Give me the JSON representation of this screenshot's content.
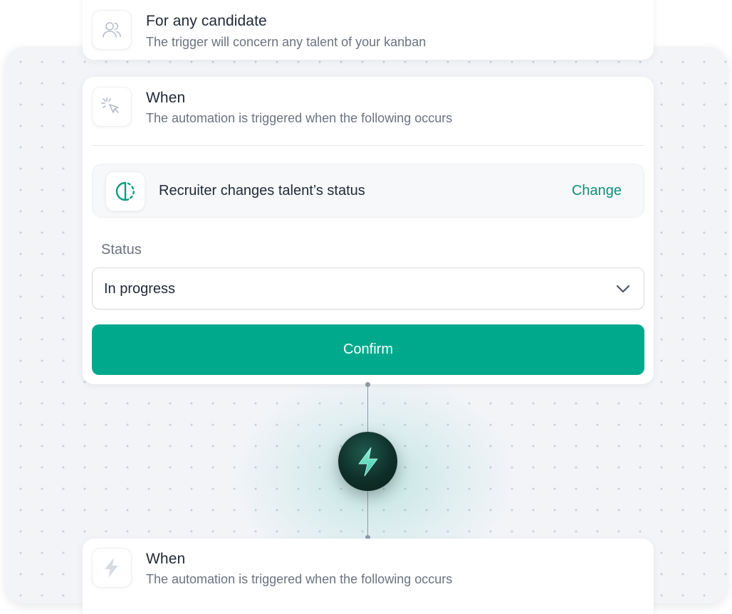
{
  "audience_step": {
    "title": "For any candidate",
    "subtitle": "The trigger will concern any talent of your kanban",
    "icon": "users-icon"
  },
  "when_step": {
    "title": "When",
    "subtitle": "The automation is triggered when the following occurs",
    "icon": "cursor-click-icon",
    "trigger": {
      "icon": "status-circle-icon",
      "label": "Recruiter changes talent’s status",
      "change_label": "Change"
    },
    "status_field": {
      "label": "Status",
      "value": "In progress"
    },
    "confirm_label": "Confirm"
  },
  "connector": {
    "icon": "lightning-bolt-icon"
  },
  "next_step": {
    "title": "When",
    "subtitle": "The automation is triggered when the following occurs",
    "icon": "lightning-bolt-icon"
  },
  "colors": {
    "accent": "#00a98c",
    "link": "#0e8f79",
    "node_dark": "#0f2f29",
    "canvas_bg": "#f2f4f8"
  }
}
